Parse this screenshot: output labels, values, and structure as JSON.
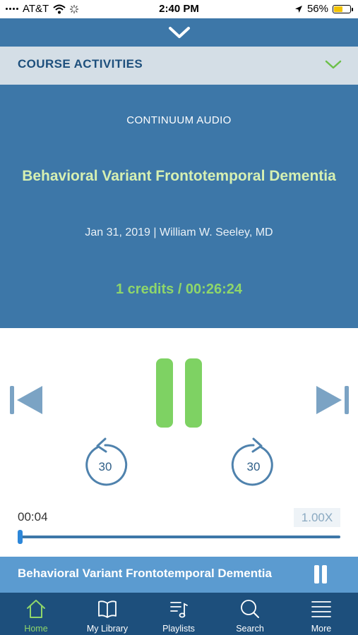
{
  "status_bar": {
    "carrier": "AT&T",
    "time": "2:40 PM",
    "battery_percent": "56%",
    "battery_level": 0.56,
    "icons": [
      "signal-icon",
      "wifi-icon",
      "activity-spinner-icon",
      "location-arrow-icon",
      "battery-icon"
    ]
  },
  "header": {
    "collapse_icon": "chevron-down-icon",
    "course_activities_label": "COURSE ACTIVITIES",
    "course_activities_icon": "chevron-down-icon"
  },
  "episode": {
    "category": "CONTINUUM AUDIO",
    "title": "Behavioral Variant Frontotemporal Dementia",
    "meta": "Jan 31, 2019 | William W. Seeley, MD",
    "credits_duration": "1 credits  /  00:26:24"
  },
  "controls": {
    "previous_icon": "skip-previous-icon",
    "pause_icon": "pause-icon",
    "next_icon": "skip-next-icon",
    "rewind_label": "30",
    "forward_label": "30"
  },
  "progress": {
    "elapsed": "00:04",
    "speed": "1.00X",
    "fraction": 0.0025
  },
  "mini_player": {
    "title": "Behavioral Variant Frontotemporal Dementia"
  },
  "tabs": [
    {
      "label": "Home",
      "icon": "home-icon",
      "active": true
    },
    {
      "label": "My Library",
      "icon": "book-icon",
      "active": false
    },
    {
      "label": "Playlists",
      "icon": "playlist-icon",
      "active": false
    },
    {
      "label": "Search",
      "icon": "search-icon",
      "active": false
    },
    {
      "label": "More",
      "icon": "menu-icon",
      "active": false
    }
  ],
  "colors": {
    "primary_blue": "#3d77a8",
    "dark_blue": "#1d4f7c",
    "accent_green": "#7ed263",
    "title_green": "#d6f0b2"
  }
}
